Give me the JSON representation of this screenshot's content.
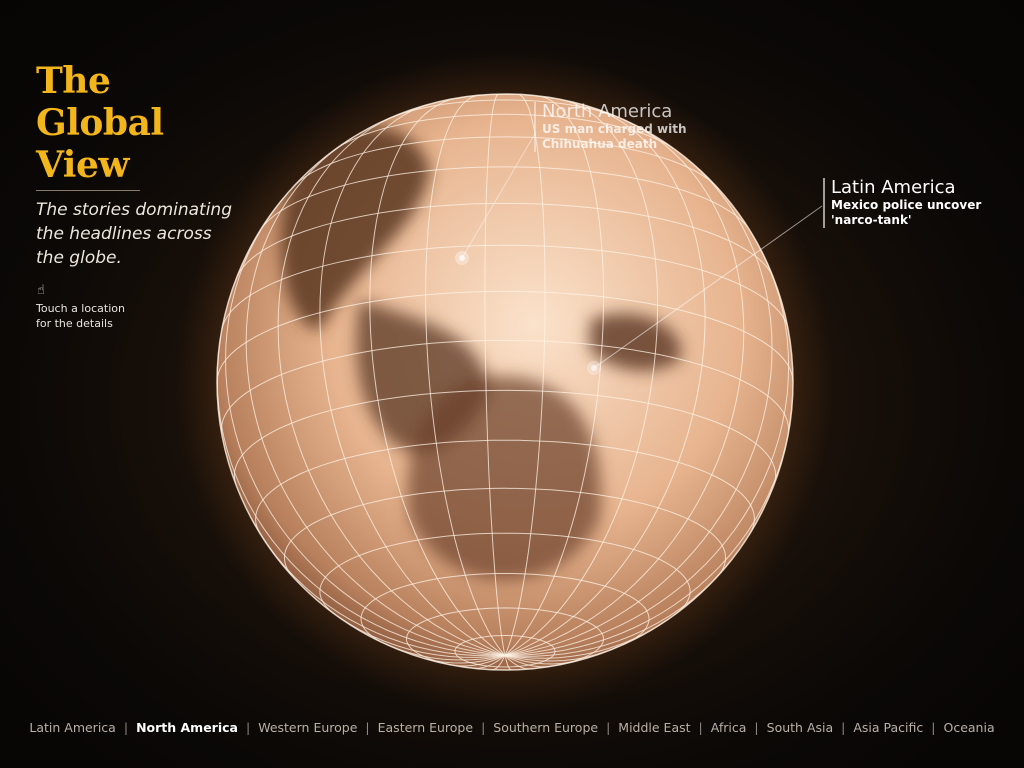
{
  "header": {
    "title_line1": "The",
    "title_line2": "Global",
    "title_line3": "View",
    "subtitle": "The stories dominating the headlines across the globe.",
    "hint_icon": "hand-pointer-icon",
    "hint": "Touch a location\nfor the details"
  },
  "callouts": [
    {
      "region": "North America",
      "headline": "US man charged with\nChihuahua death"
    },
    {
      "region": "Latin America",
      "headline": "Mexico police uncover\n'narco-tank'"
    }
  ],
  "nav": {
    "items": [
      {
        "label": "Latin America"
      },
      {
        "label": "North America",
        "active": true
      },
      {
        "label": "Western Europe"
      },
      {
        "label": "Eastern Europe"
      },
      {
        "label": "Southern Europe"
      },
      {
        "label": "Middle East"
      },
      {
        "label": "Africa"
      },
      {
        "label": "South Asia"
      },
      {
        "label": "Asia Pacific"
      },
      {
        "label": "Oceania"
      }
    ],
    "separator": "|"
  },
  "colors": {
    "title": "#f2b51b",
    "globe_light": "#f6d3b6",
    "globe_dark": "#4a2c1a",
    "grid": "#fff3e6",
    "background": "#0b0806"
  }
}
